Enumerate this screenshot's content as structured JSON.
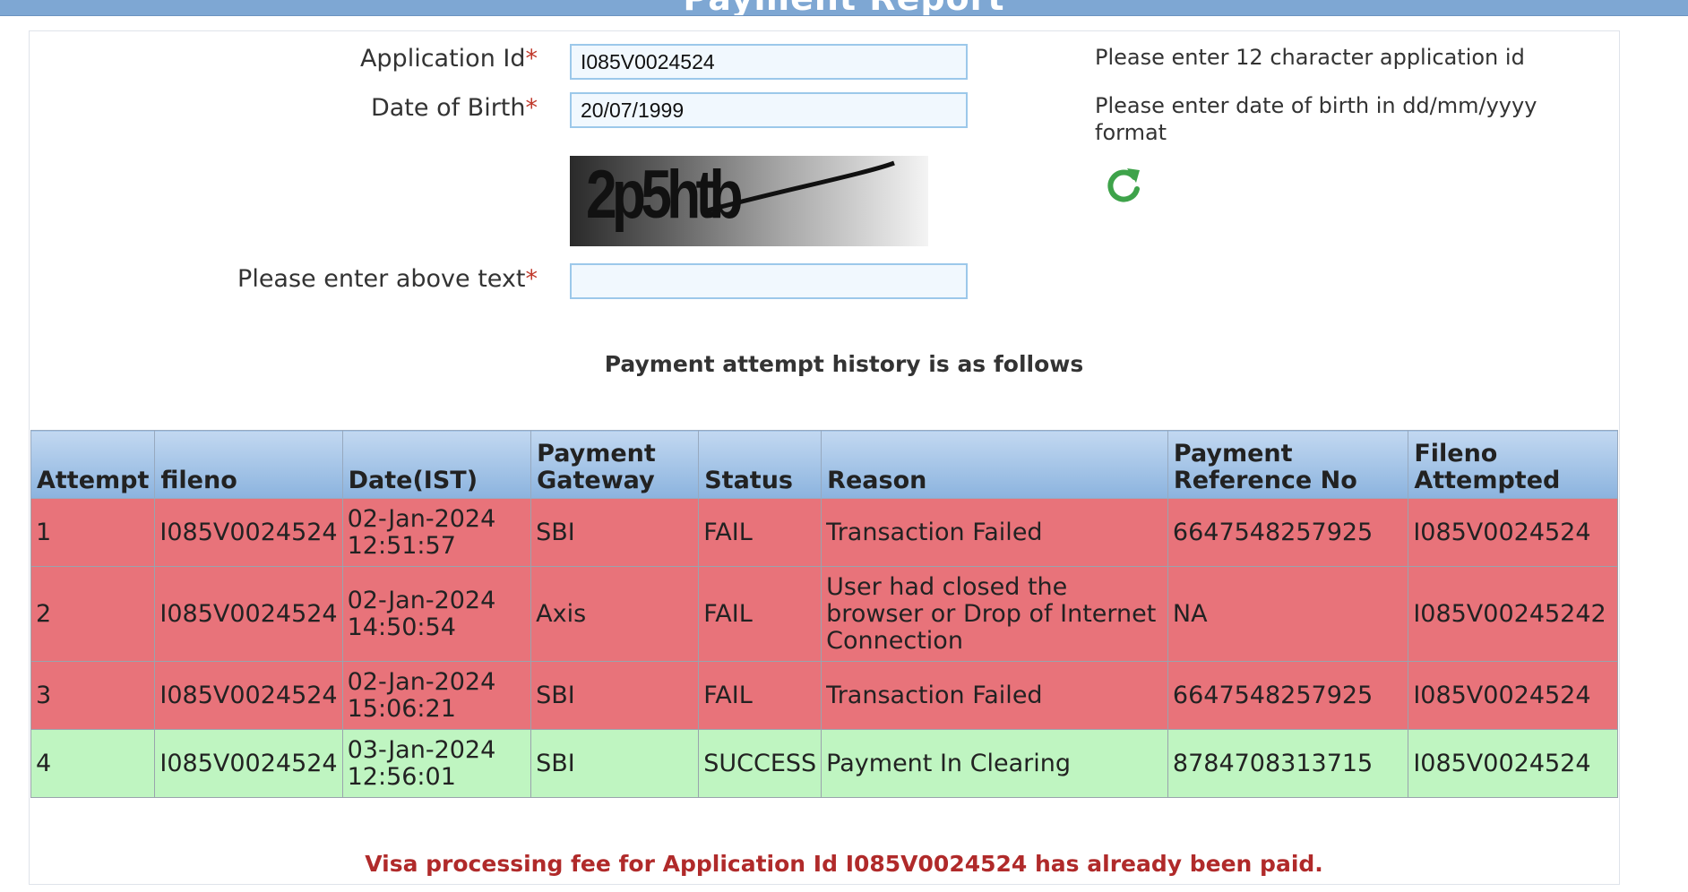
{
  "page": {
    "title": "Payment Report"
  },
  "form": {
    "application_id": {
      "label": "Application Id",
      "required": "*",
      "value": "I085V0024524",
      "hint": "Please enter 12 character application id"
    },
    "dob": {
      "label": "Date of Birth",
      "required": "*",
      "value": "20/07/1999",
      "hint": "Please enter date of birth in dd/mm/yyyy format"
    },
    "captcha": {
      "image_text": "2p5htb",
      "refresh_icon": "refresh-icon"
    },
    "captcha_input": {
      "label": "Please enter above text",
      "required": "*",
      "value": ""
    }
  },
  "history": {
    "title": "Payment attempt history is as follows",
    "columns": [
      "Attempt",
      "fileno",
      "Date(IST)",
      "Payment Gateway",
      "Status",
      "Reason",
      "Payment Reference No",
      "Fileno Attempted"
    ],
    "rows": [
      {
        "attempt": "1",
        "fileno": "I085V0024524",
        "date": "02-Jan-2024 12:51:57",
        "gateway": "SBI",
        "status": "FAIL",
        "reason": "Transaction Failed",
        "ref": "6647548257925",
        "fileno_attempted": "I085V0024524"
      },
      {
        "attempt": "2",
        "fileno": "I085V0024524",
        "date": "02-Jan-2024 14:50:54",
        "gateway": "Axis",
        "status": "FAIL",
        "reason": "User had closed the browser or Drop of Internet Connection",
        "ref": "NA",
        "fileno_attempted": "I085V00245242"
      },
      {
        "attempt": "3",
        "fileno": "I085V0024524",
        "date": "02-Jan-2024 15:06:21",
        "gateway": "SBI",
        "status": "FAIL",
        "reason": "Transaction Failed",
        "ref": "6647548257925",
        "fileno_attempted": "I085V0024524"
      },
      {
        "attempt": "4",
        "fileno": "I085V0024524",
        "date": "03-Jan-2024 12:56:01",
        "gateway": "SBI",
        "status": "SUCCESS",
        "reason": "Payment In Clearing",
        "ref": "8784708313715",
        "fileno_attempted": "I085V0024524"
      }
    ]
  },
  "message": "Visa processing fee for Application Id I085V0024524 has already been paid.",
  "colors": {
    "header_blue": "#7ea7d3",
    "fail_row": "#e8737a",
    "success_row": "#bff5c1",
    "message_red": "#b02a2a",
    "refresh_green": "#3ea34a"
  }
}
